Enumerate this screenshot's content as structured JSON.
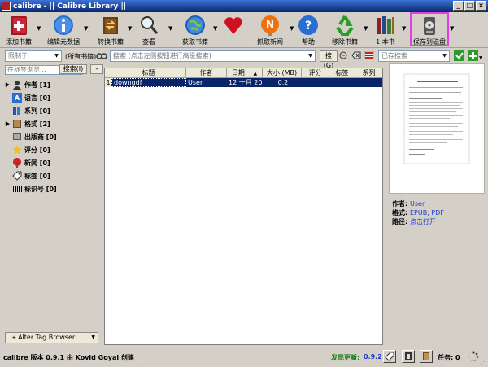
{
  "window": {
    "title": "calibre - || Calibre Library ||",
    "minimize": "_",
    "maximize": "□",
    "close": "×"
  },
  "toolbar": {
    "add_books": "添加书籍",
    "edit_metadata": "编辑元数据",
    "convert_books": "转换书籍",
    "view": "查看",
    "get_books": "获取书籍",
    "fetch_news": "抓取新闻",
    "help": "帮助",
    "remove_books": "移除书籍",
    "one_book": "1 本书",
    "save_to_disk": "保存到磁盘"
  },
  "search": {
    "restrict": "限制于",
    "all_books": "(所有书籍)",
    "placeholder": "搜索 (点击左侧按钮进行高级搜索)",
    "search_button": "搜(G)",
    "saved_search_placeholder": "已存搜索"
  },
  "tag_browser": {
    "find_placeholder": "在标签浏览...",
    "find_button": "搜索(I)",
    "collapse": "-",
    "items": [
      {
        "label": "作者 [1]",
        "expanded": true
      },
      {
        "label": "语言 [0]",
        "expanded": false
      },
      {
        "label": "系列 [0]",
        "expanded": false
      },
      {
        "label": "格式 [2]",
        "expanded": true
      },
      {
        "label": "出版商 [0]",
        "expanded": false
      },
      {
        "label": "评分 [0]",
        "expanded": false
      },
      {
        "label": "新闻 [0]",
        "expanded": false
      },
      {
        "label": "标签 [0]",
        "expanded": false
      },
      {
        "label": "标识号 [0]",
        "expanded": false
      }
    ],
    "alter_button": "Alter Tag Browser"
  },
  "book_list": {
    "columns": [
      "标题",
      "作者",
      "日期",
      "大小 (MB)",
      "评分",
      "标签",
      "系列"
    ],
    "sort_indicator": "▲",
    "rows": [
      {
        "num": "1",
        "title": "downgdf",
        "author": "User",
        "date": "12 十月 2012",
        "size": "0.2",
        "rating": "",
        "tags": "",
        "series": ""
      }
    ]
  },
  "details": {
    "author_label": "作者:",
    "author_value": "User",
    "format_label": "格式:",
    "format_value": "EPUB, PDF",
    "path_label": "路径:",
    "path_value": "点击打开"
  },
  "statusbar": {
    "version_text": "calibre 版本 0.9.1 由 Kovid Goyal 创建",
    "update_label": "发现更新:",
    "update_version": "0.9.2",
    "tasks": "任务: 0"
  },
  "colors": {
    "selection": "#0a246a",
    "link": "#1a3dd1",
    "update_green": "#1a7d1a",
    "highlight_border": "#e040e0"
  }
}
